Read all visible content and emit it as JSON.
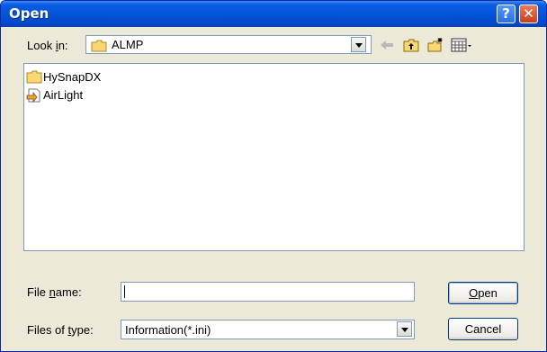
{
  "window": {
    "title": "Open"
  },
  "title_buttons": {
    "help": "?",
    "close": "✕"
  },
  "lookin": {
    "label_pre": "Look ",
    "label_u": "i",
    "label_post": "n:",
    "value": "ALMP"
  },
  "toolbar": {
    "icons": [
      "back-icon",
      "up-folder-icon",
      "new-folder-icon",
      "view-menu-icon"
    ]
  },
  "files": [
    {
      "name": "HySnapDX",
      "icon": "folder-icon"
    },
    {
      "name": "AirLight",
      "icon": "shortcut-file-icon"
    }
  ],
  "filename": {
    "label_pre": "File ",
    "label_u": "n",
    "label_post": "ame:",
    "value": ""
  },
  "filetype": {
    "label_pre": "Files of ",
    "label_u": "t",
    "label_post": "ype:",
    "value": "Information(*.ini)"
  },
  "buttons": {
    "open_u": "O",
    "open_rest": "pen",
    "cancel": "Cancel"
  },
  "colors": {
    "titlebar": "#0553d8",
    "dialog_bg": "#ece9d8",
    "border": "#7f9db9"
  }
}
